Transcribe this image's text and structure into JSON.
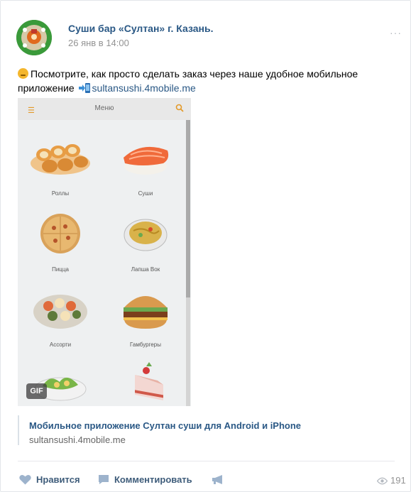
{
  "post": {
    "author": "Суши бар «Султан» г. Казань.",
    "date": "26 янв в 14:00",
    "more_label": "···",
    "text_main": "Посмотрите, как просто сделать заказ через наше удобное мобильное приложение",
    "text_link": "sultansushi.4mobile.me"
  },
  "gif_preview": {
    "menu_title": "Меню",
    "badge": "GIF",
    "categories": [
      "Роллы",
      "Суши",
      "Пицца",
      "Лапша Вок",
      "Ассорти",
      "Гамбургеры"
    ]
  },
  "link_card": {
    "title": "Мобильное приложение Султан суши для Android и iPhone",
    "url": "sultansushi.4mobile.me"
  },
  "actions": {
    "like_label": "Нравится",
    "comment_label": "Комментировать",
    "views_count": "191"
  },
  "colors": {
    "link": "#2a5885",
    "meta": "#939393",
    "accent_menu": "#e39a2a"
  }
}
